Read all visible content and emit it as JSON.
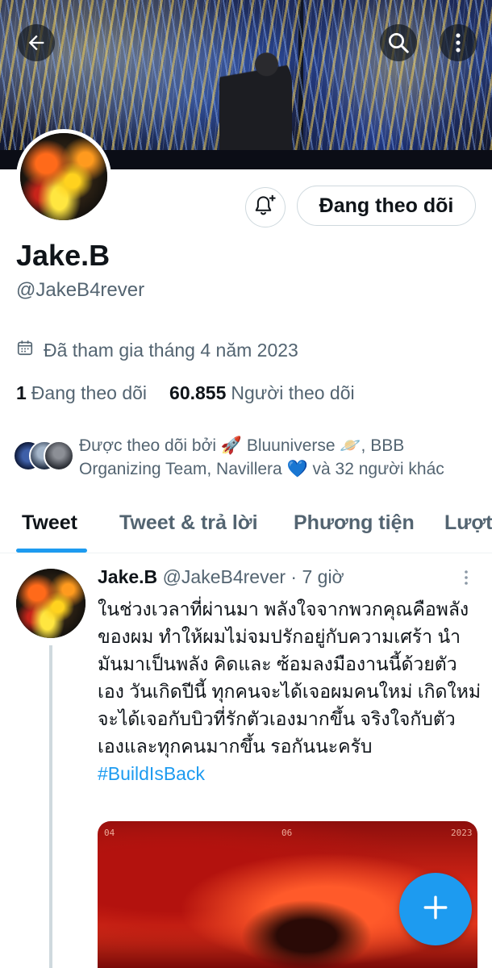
{
  "profile": {
    "display_name": "Jake.B",
    "handle": "@JakeB4rever",
    "joined": "Đã tham gia tháng 4 năm 2023",
    "following_count": "1",
    "following_label": "Đang theo dõi",
    "followers_count": "60.855",
    "followers_label": "Người theo dõi",
    "follow_button_label": "Đang theo dõi",
    "followed_by": "Được theo dõi bởi 🚀 Bluuniverse 🪐, BBB Organizing Team, Navillera 💙 và 32 người khác"
  },
  "tabs": [
    {
      "label": "Tweet",
      "active": true
    },
    {
      "label": "Tweet & trả lời",
      "active": false
    },
    {
      "label": "Phương tiện",
      "active": false
    },
    {
      "label": "Lượt",
      "active": false
    }
  ],
  "tweet": {
    "author": "Jake.B",
    "handle_time": "@JakeB4rever · 7 giờ",
    "text": "ในช่วงเวลาที่ผ่านมา พลังใจจากพวกคุณคือพลังของผม ทำให้ผมไม่จมปรักอยู่กับความเศร้า นำมันมาเป็นพลัง คิดและ ซ้อมลงมืองานนี้ด้วยตัวเอง วันเกิดปีนี้ ทุกคนจะได้เจอผมคนใหม่ เกิดใหม่ จะได้เจอกับบิวที่รักตัวเองมากขึ้น จริงใจกับตัวเองและทุกคนมากขึ้น รอกันนะครับ",
    "hashtag": "#BuildIsBack",
    "media_labels": [
      "04",
      "06",
      "2023"
    ]
  },
  "icons": {
    "back": "back-arrow-icon",
    "search": "search-icon",
    "more": "more-vertical-icon",
    "bell": "bell-plus-icon",
    "calendar": "calendar-icon",
    "compose": "plus-icon"
  },
  "colors": {
    "accent": "#1d9bf0",
    "secondary_text": "#536471",
    "primary_text": "#0f1419"
  }
}
